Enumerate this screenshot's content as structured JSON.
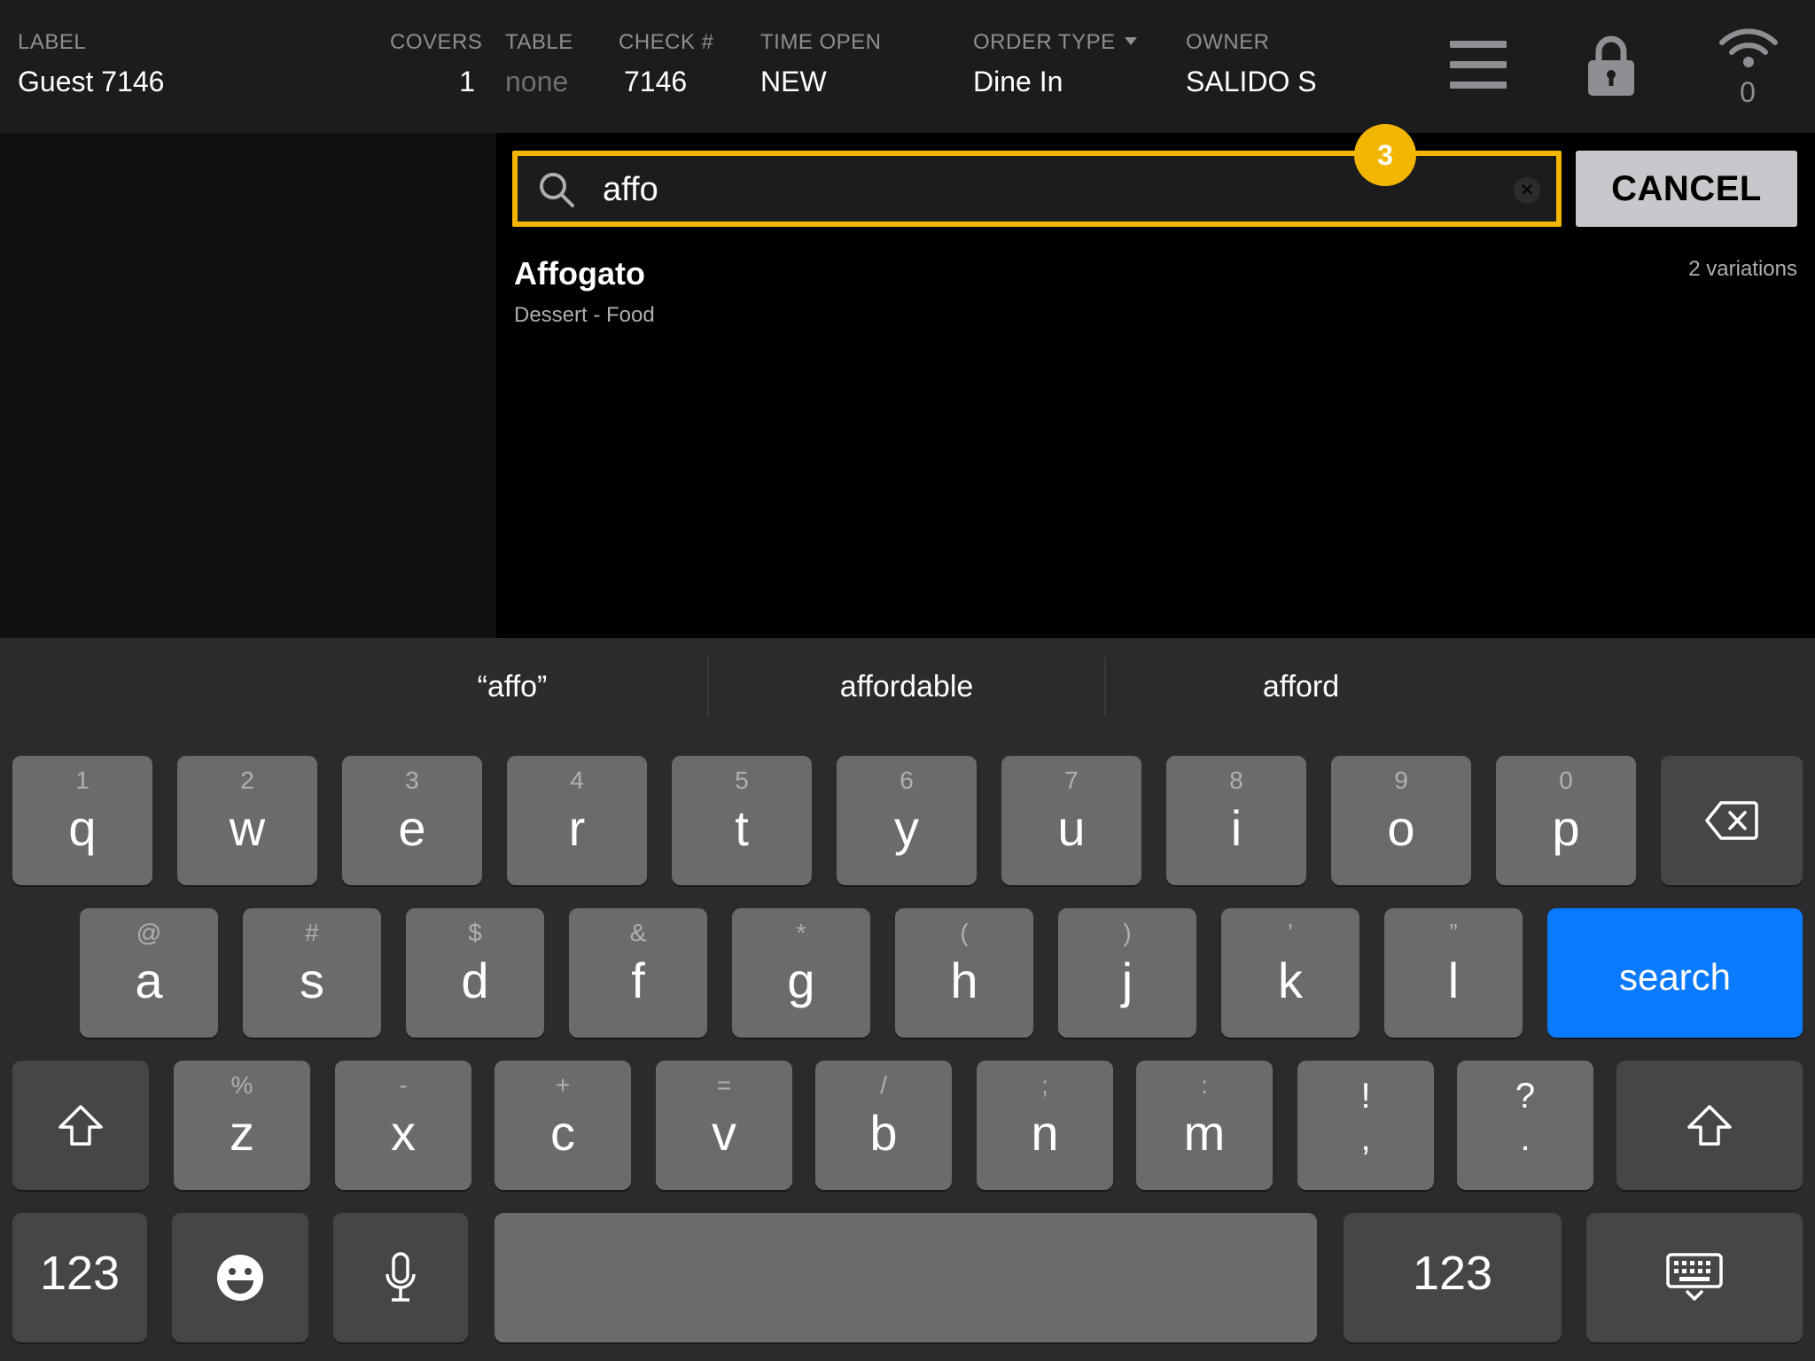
{
  "header": {
    "label": {
      "title": "LABEL",
      "value": "Guest 7146"
    },
    "covers": {
      "title": "COVERS",
      "value": "1"
    },
    "table": {
      "title": "TABLE",
      "value": "none"
    },
    "check": {
      "title": "CHECK #",
      "value": "7146"
    },
    "time_open": {
      "title": "TIME OPEN",
      "value": "NEW"
    },
    "order_type": {
      "title": "ORDER TYPE",
      "value": "Dine In"
    },
    "owner": {
      "title": "OWNER",
      "value": "SALIDO S"
    },
    "wifi_count": "0"
  },
  "search": {
    "value": "affo",
    "step_badge": "3",
    "cancel_label": "CANCEL"
  },
  "results": [
    {
      "name": "Affogato",
      "subtitle": "Dessert - Food",
      "variations": "2 variations"
    }
  ],
  "keyboard": {
    "suggestions": [
      "“affo”",
      "affordable",
      "afford"
    ],
    "row1": [
      {
        "main": "q",
        "top": "1"
      },
      {
        "main": "w",
        "top": "2"
      },
      {
        "main": "e",
        "top": "3"
      },
      {
        "main": "r",
        "top": "4"
      },
      {
        "main": "t",
        "top": "5"
      },
      {
        "main": "y",
        "top": "6"
      },
      {
        "main": "u",
        "top": "7"
      },
      {
        "main": "i",
        "top": "8"
      },
      {
        "main": "o",
        "top": "9"
      },
      {
        "main": "p",
        "top": "0"
      }
    ],
    "row2": [
      {
        "main": "a",
        "top": "@"
      },
      {
        "main": "s",
        "top": "#"
      },
      {
        "main": "d",
        "top": "$"
      },
      {
        "main": "f",
        "top": "&"
      },
      {
        "main": "g",
        "top": "*"
      },
      {
        "main": "h",
        "top": "("
      },
      {
        "main": "j",
        "top": ")"
      },
      {
        "main": "k",
        "top": "’"
      },
      {
        "main": "l",
        "top": "”"
      }
    ],
    "row3": [
      {
        "main": "z",
        "top": "%"
      },
      {
        "main": "x",
        "top": "-"
      },
      {
        "main": "c",
        "top": "+"
      },
      {
        "main": "v",
        "top": "="
      },
      {
        "main": "b",
        "top": "/"
      },
      {
        "main": "n",
        "top": ";"
      },
      {
        "main": "m",
        "top": ":"
      },
      {
        "main": ",",
        "top": "!"
      },
      {
        "main": ".",
        "top": "?"
      }
    ],
    "search_label": "search",
    "numbers_label": "123",
    "icons": [
      "backspace-icon",
      "shift-icon",
      "emoji-icon",
      "microphone-icon",
      "keyboard-dismiss-icon",
      "search-icon",
      "lock-icon",
      "wifi-icon",
      "menu-icon"
    ],
    "accent_color": "#0a7aff",
    "highlight_color": "#f2b600"
  }
}
